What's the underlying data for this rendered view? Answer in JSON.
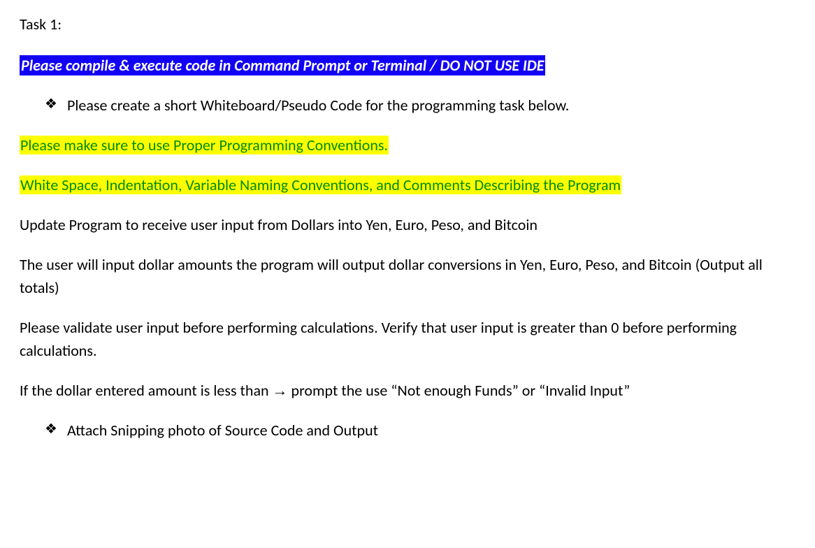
{
  "task_title": "Task 1:",
  "instruction_highlight": "Please compile & execute code in Command Prompt or Terminal / DO NOT USE IDE",
  "bullet_1": "Please create a short Whiteboard/Pseudo Code for the programming task below.",
  "green_line_1": "Please make sure to use Proper Programming Conventions.",
  "green_line_2": "White Space, Indentation, Variable Naming Conventions, and Comments Describing the Program",
  "body_1": "Update Program to receive user input from Dollars into Yen, Euro, Peso, and Bitcoin",
  "body_2": "The user will input dollar amounts the program will output dollar conversions in Yen, Euro, Peso, and Bitcoin (Output all totals)",
  "body_3": "Please validate user input before performing calculations. Verify that user input is greater than 0 before performing calculations.",
  "body_4_pre": "If the dollar entered amount is less than ",
  "body_4_arrow": "→",
  "body_4_post": " prompt the use “Not enough Funds” or “Invalid Input”",
  "bullet_2": "Attach Snipping photo of Source Code and Output"
}
